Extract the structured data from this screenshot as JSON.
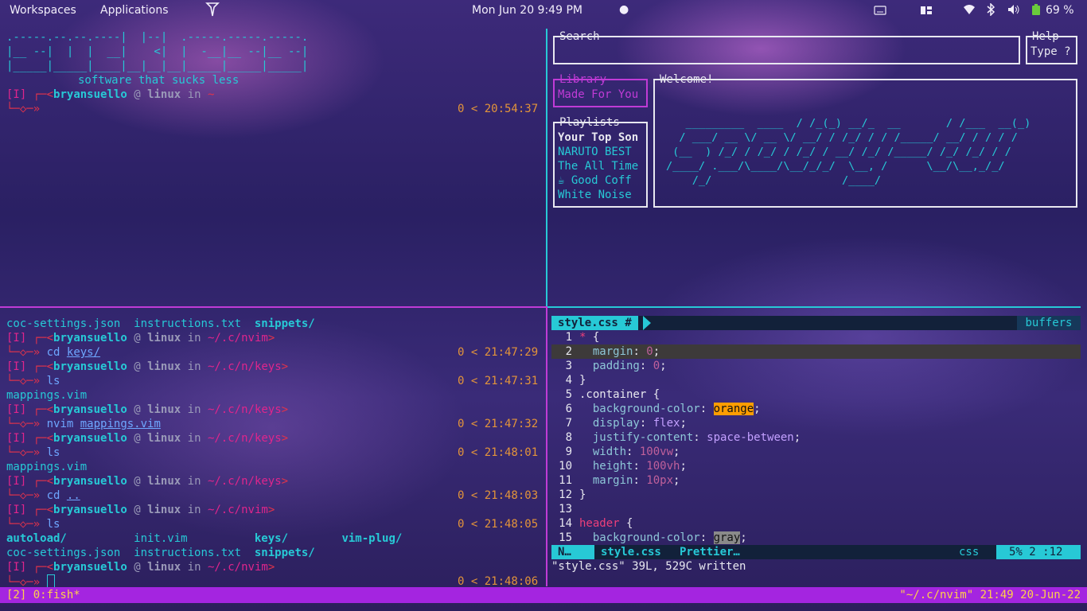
{
  "topbar": {
    "workspaces": "Workspaces",
    "applications": "Applications",
    "datetime": "Mon Jun 20  9:49 PM",
    "battery": "69 %"
  },
  "top_left": {
    "logo_lines": [
      ".-----.--.--.----|  |--|  .-----.-----.-----.",
      "|__ --|  |  |  __|    <|  |  -__|__ --|__ --|",
      "|_____|_____|____|__|__|__|_____|_____|_____|"
    ],
    "tagline": "software that sucks less",
    "prompt_mode": "[I]",
    "prompt_user": "bryansuello",
    "prompt_at": "@",
    "prompt_host": "linux",
    "prompt_in": "in",
    "prompt_dir": "~",
    "prompt_time": "0 < 20:54:37"
  },
  "top_right": {
    "search_title": "Search",
    "help_title": "Help",
    "help_text": "Type ?",
    "library_title": "Library",
    "library_item": "Made For You",
    "playlists_title": "Playlists",
    "playlists": [
      "Your Top Son",
      "NARUTO BEST",
      "The All Time",
      "☕ Good Coff",
      "White Noise"
    ],
    "welcome_title": "Welcome!",
    "welcome_art": [
      "   _________  ____  / /_(_) __/_  __       / /___  __(_)",
      "  / ___/ __ \\/ __ \\/ __/ / /_/ / / /_____/ __/ / / / /",
      " (__  ) /_/ / /_/ / /_/ / __/ /_/ /_____/ /_/ /_/ / /",
      "/____/ .___/\\____/\\__/_/_/  \\__, /      \\__/\\__,_/_/",
      "    /_/                    /____/"
    ]
  },
  "bottom_left": {
    "lines": [
      {
        "kind": "ls",
        "items": [
          {
            "t": "coc-settings.json",
            "c": "cyan"
          },
          {
            "t": "  instructions.txt",
            "c": "cyan"
          },
          {
            "t": "  snippets/",
            "c": "cyan",
            "b": true
          }
        ]
      },
      {
        "kind": "prompt",
        "dir": "~/.c/nvim"
      },
      {
        "kind": "cmd",
        "cmd": "cd",
        "arg": "keys/",
        "time": "0 < 21:47:29"
      },
      {
        "kind": "prompt",
        "dir": "~/.c/n/keys"
      },
      {
        "kind": "cmd",
        "cmd": "ls",
        "arg": "",
        "time": "0 < 21:47:31"
      },
      {
        "kind": "out",
        "text": "mappings.vim"
      },
      {
        "kind": "prompt",
        "dir": "~/.c/n/keys"
      },
      {
        "kind": "cmd",
        "cmd": "nvim",
        "arg": "mappings.vim",
        "time": "0 < 21:47:32"
      },
      {
        "kind": "prompt",
        "dir": "~/.c/n/keys"
      },
      {
        "kind": "cmd",
        "cmd": "ls",
        "arg": "",
        "time": "0 < 21:48:01"
      },
      {
        "kind": "out",
        "text": "mappings.vim"
      },
      {
        "kind": "prompt",
        "dir": "~/.c/n/keys"
      },
      {
        "kind": "cmd",
        "cmd": "cd",
        "arg": "..",
        "time": "0 < 21:48:03"
      },
      {
        "kind": "prompt",
        "dir": "~/.c/nvim"
      },
      {
        "kind": "cmd",
        "cmd": "ls",
        "arg": "",
        "time": "0 < 21:48:05"
      },
      {
        "kind": "ls",
        "items": [
          {
            "t": "autoload/",
            "c": "cyan",
            "b": true
          },
          {
            "t": "          init.vim",
            "c": "cyan"
          },
          {
            "t": "          keys/",
            "c": "cyan",
            "b": true
          },
          {
            "t": "        vim-plug/",
            "c": "cyan",
            "b": true
          }
        ]
      },
      {
        "kind": "ls",
        "items": [
          {
            "t": "coc-settings.json",
            "c": "cyan"
          },
          {
            "t": "  instructions.txt",
            "c": "cyan"
          },
          {
            "t": "  snippets/",
            "c": "cyan",
            "b": true
          }
        ]
      },
      {
        "kind": "prompt",
        "dir": "~/.c/nvim"
      },
      {
        "kind": "cmd",
        "cmd": "",
        "arg": "",
        "time": "0 < 21:48:06",
        "cursor": true
      }
    ],
    "prompt_mode": "[I]",
    "prompt_user": "bryansuello",
    "prompt_host": "linux"
  },
  "vim": {
    "tab_file": "style.css #",
    "tab_buffers": "buffers",
    "lines": [
      {
        "n": "1",
        "code": [
          {
            "t": "* ",
            "c": "sel"
          },
          {
            "t": "{",
            "c": "white"
          }
        ]
      },
      {
        "n": "2",
        "code": [
          {
            "t": "  margin",
            "c": "prop"
          },
          {
            "t": ": ",
            "c": "white"
          },
          {
            "t": "0",
            "c": "num"
          },
          {
            "t": ";",
            "c": "white"
          }
        ],
        "current": true
      },
      {
        "n": "3",
        "code": [
          {
            "t": "  padding",
            "c": "prop"
          },
          {
            "t": ": ",
            "c": "white"
          },
          {
            "t": "0",
            "c": "num"
          },
          {
            "t": ";",
            "c": "white"
          }
        ]
      },
      {
        "n": "4",
        "code": [
          {
            "t": "}",
            "c": "white"
          }
        ]
      },
      {
        "n": "5",
        "code": [
          {
            "t": ".container ",
            "c": "white"
          },
          {
            "t": "{",
            "c": "white"
          }
        ]
      },
      {
        "n": "6",
        "code": [
          {
            "t": "  background-color",
            "c": "prop"
          },
          {
            "t": ": ",
            "c": "white"
          },
          {
            "t": "orange",
            "c": "hl-orange"
          },
          {
            "t": ";",
            "c": "white"
          }
        ]
      },
      {
        "n": "7",
        "code": [
          {
            "t": "  display",
            "c": "prop"
          },
          {
            "t": ": ",
            "c": "white"
          },
          {
            "t": "flex",
            "c": "kw"
          },
          {
            "t": ";",
            "c": "white"
          }
        ]
      },
      {
        "n": "8",
        "code": [
          {
            "t": "  justify-content",
            "c": "prop"
          },
          {
            "t": ": ",
            "c": "white"
          },
          {
            "t": "space-between",
            "c": "kw"
          },
          {
            "t": ";",
            "c": "white"
          }
        ]
      },
      {
        "n": "9",
        "code": [
          {
            "t": "  width",
            "c": "prop"
          },
          {
            "t": ": ",
            "c": "white"
          },
          {
            "t": "100vw",
            "c": "num"
          },
          {
            "t": ";",
            "c": "white"
          }
        ]
      },
      {
        "n": "10",
        "code": [
          {
            "t": "  height",
            "c": "prop"
          },
          {
            "t": ": ",
            "c": "white"
          },
          {
            "t": "100vh",
            "c": "num"
          },
          {
            "t": ";",
            "c": "white"
          }
        ]
      },
      {
        "n": "11",
        "code": [
          {
            "t": "  margin",
            "c": "prop"
          },
          {
            "t": ": ",
            "c": "white"
          },
          {
            "t": "10px",
            "c": "num"
          },
          {
            "t": ";",
            "c": "white"
          }
        ]
      },
      {
        "n": "12",
        "code": [
          {
            "t": "}",
            "c": "white"
          }
        ]
      },
      {
        "n": "13",
        "code": []
      },
      {
        "n": "14",
        "code": [
          {
            "t": "header ",
            "c": "sel"
          },
          {
            "t": "{",
            "c": "white"
          }
        ]
      },
      {
        "n": "15",
        "code": [
          {
            "t": "  background-color",
            "c": "prop"
          },
          {
            "t": ": ",
            "c": "white"
          },
          {
            "t": "gray",
            "c": "hl-gray"
          },
          {
            "t": ";",
            "c": "white"
          }
        ]
      }
    ],
    "status_mode": "N…",
    "status_file": "style.css",
    "status_formatter": "Prettier…",
    "status_ft": "css",
    "status_pos": "5%",
    "status_col": "2 :12",
    "message": "\"style.css\" 39L, 529C written"
  },
  "tmux": {
    "left": "[2] 0:fish*",
    "right": "\"~/.c/nvim\" 21:49 20-Jun-22"
  },
  "colors": {
    "cyan": "#27c9d6",
    "magenta": "#c03bd6",
    "tmux_bg": "#a425e0",
    "tmux_fg": "#ffd04a"
  }
}
